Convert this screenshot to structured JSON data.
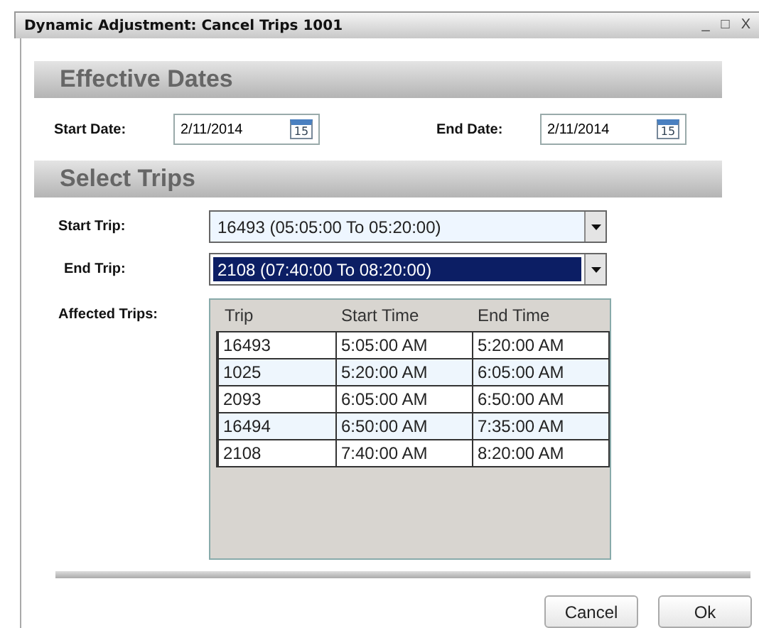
{
  "window": {
    "title": "Dynamic Adjustment: Cancel Trips 1001",
    "controls": [
      "_",
      "□",
      "X"
    ]
  },
  "effective_dates": {
    "heading": "Effective Dates",
    "start_label": "Start Date:",
    "start_value": "2/11/2014",
    "start_calendar_day": "15",
    "end_label": "End Date:",
    "end_value": "2/11/2014",
    "end_calendar_day": "15"
  },
  "select_trips": {
    "heading": "Select Trips",
    "start_label": "Start Trip:",
    "start_value": "16493 (05:05:00 To 05:20:00)",
    "start_focused": false,
    "end_label": "End Trip:",
    "end_value": "2108 (07:40:00 To 08:20:00)",
    "end_focused": true,
    "affected_label": "Affected Trips:"
  },
  "table": {
    "columns": [
      "Trip",
      "Start Time",
      "End Time"
    ],
    "rows": [
      [
        "16493",
        "5:05:00 AM",
        "5:20:00 AM"
      ],
      [
        "1025",
        "5:20:00 AM",
        "6:05:00 AM"
      ],
      [
        "2093",
        "6:05:00 AM",
        "6:50:00 AM"
      ],
      [
        "16494",
        "6:50:00 AM",
        "7:35:00 AM"
      ],
      [
        "2108",
        "7:40:00 AM",
        "8:20:00 AM"
      ]
    ]
  },
  "buttons": [
    "Cancel",
    "Ok"
  ]
}
